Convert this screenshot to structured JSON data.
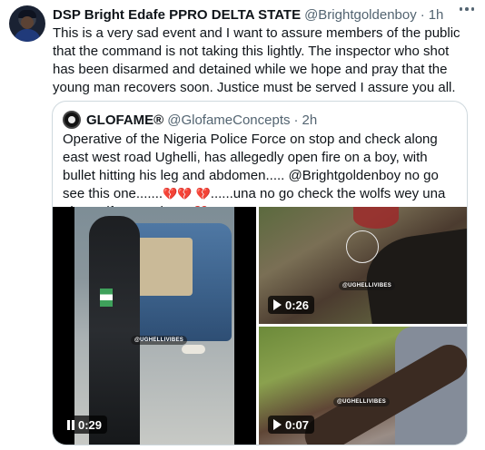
{
  "tweet": {
    "author_name": "DSP Bright Edafe PPRO DELTA STATE",
    "author_handle": "@Brightgoldenboy",
    "separator": "·",
    "time": "1h",
    "text": "This is a very sad event and I want to assure members of the public that the command is not taking this lightly. The inspector who shot has been disarmed and detained while we hope and pray that the young man recovers soon. Justice must be served I assure you all.",
    "more_icon": "more-horizontal-icon"
  },
  "quoted_tweet": {
    "author_name": "GLOFAME®",
    "author_handle": "@GlofameConcepts",
    "separator": "·",
    "time": "2h",
    "text_part1": "Operative of the Nigeria Police Force on stop and check along east west road Ughelli, has allegedly open fire on a boy, with bullet hitting his leg and abdomen..... @Brightgoldenboy no go see this one.......",
    "text_part2": "......una no go check the wolfs wey una give uniform and gun",
    "heart_glyph": "💔",
    "media": [
      {
        "type": "video",
        "state": "playing",
        "duration": "0:29",
        "watermark": "@UGHELLIVIBES"
      },
      {
        "type": "video",
        "state": "paused",
        "duration": "0:26",
        "watermark": "@UGHELLIVIBES"
      },
      {
        "type": "video",
        "state": "paused",
        "duration": "0:07",
        "watermark": "@UGHELLIVIBES"
      }
    ]
  },
  "colors": {
    "text_primary": "#0f1419",
    "text_secondary": "#536471",
    "border": "#cfd9de",
    "heart": "#d6263b"
  }
}
